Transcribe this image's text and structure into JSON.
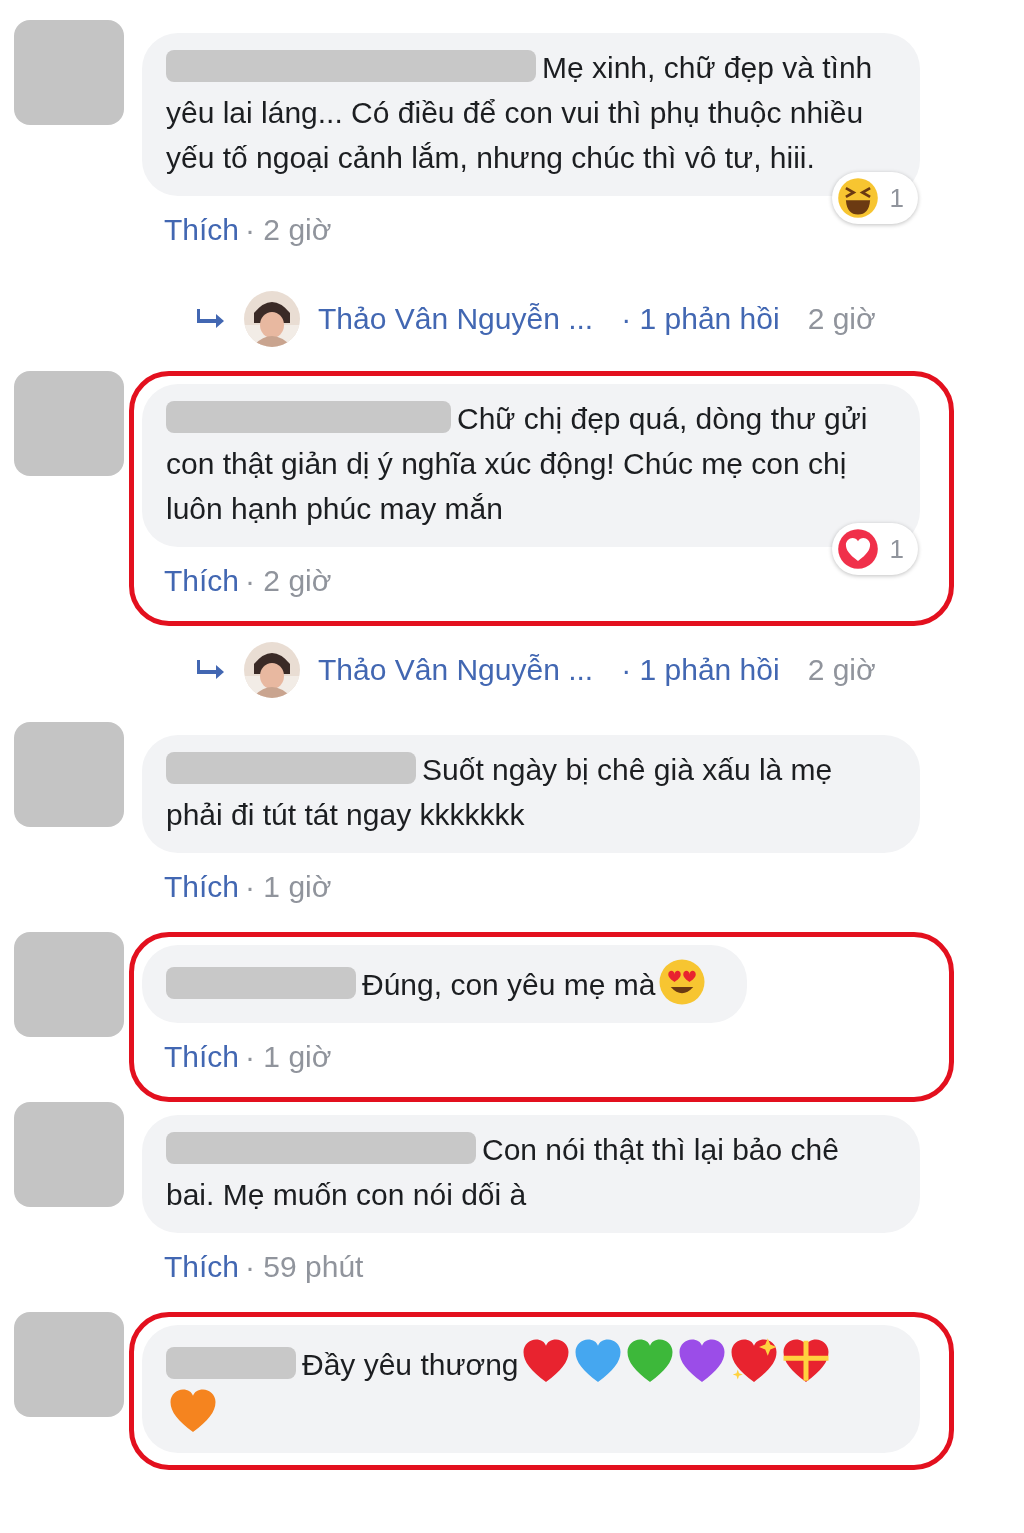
{
  "comments": [
    {
      "highlighted": false,
      "text": "Mẹ xinh, chữ đẹp và tình yêu lai láng... Có điều để con vui thì phụ thuộc nhiều yếu tố ngoại cảnh lắm, nhưng chúc thì vô tư, hiii.",
      "reaction": {
        "kind": "haha",
        "count": "1"
      },
      "like": "Thích",
      "time": "· 2 giờ",
      "reply": {
        "name": "Thảo Vân Nguyễn ...",
        "count": "· 1 phản hồi",
        "time": "2 giờ"
      }
    },
    {
      "highlighted": true,
      "text": "Chữ chị đẹp quá, dòng thư gửi con thật giản dị ý nghĩa xúc động! Chúc mẹ con chị luôn hạnh phúc may mắn",
      "reaction": {
        "kind": "love",
        "count": "1"
      },
      "like": "Thích",
      "time": "· 2 giờ",
      "reply": {
        "name": "Thảo Vân Nguyễn ...",
        "count": "· 1 phản hồi",
        "time": "2 giờ"
      }
    },
    {
      "highlighted": false,
      "text": "Suốt ngày bị chê già xấu là mẹ phải đi tút tát ngay kkkkkkk",
      "like": "Thích",
      "time": "· 1 giờ"
    },
    {
      "highlighted": true,
      "text": "Đúng, con yêu mẹ mà",
      "emojis": [
        {
          "kind": "heart-eyes"
        }
      ],
      "like": "Thích",
      "time": "· 1 giờ"
    },
    {
      "highlighted": false,
      "text": "Con nói thật thì lại bảo chê bai. Mẹ muốn con nói dối à",
      "like": "Thích",
      "time": "· 59 phút"
    },
    {
      "highlighted": true,
      "text": "Đầy yêu thương",
      "emojis": [
        {
          "kind": "heart",
          "color": "#e8232f"
        },
        {
          "kind": "heart",
          "color": "#45a7f0"
        },
        {
          "kind": "heart",
          "color": "#3db83a"
        },
        {
          "kind": "heart",
          "color": "#9b4de8"
        },
        {
          "kind": "sparkling-heart",
          "color": "#e8232f"
        },
        {
          "kind": "gift-heart",
          "color": "#e8232f"
        },
        {
          "kind": "heart",
          "color": "#f5841f"
        }
      ]
    }
  ]
}
